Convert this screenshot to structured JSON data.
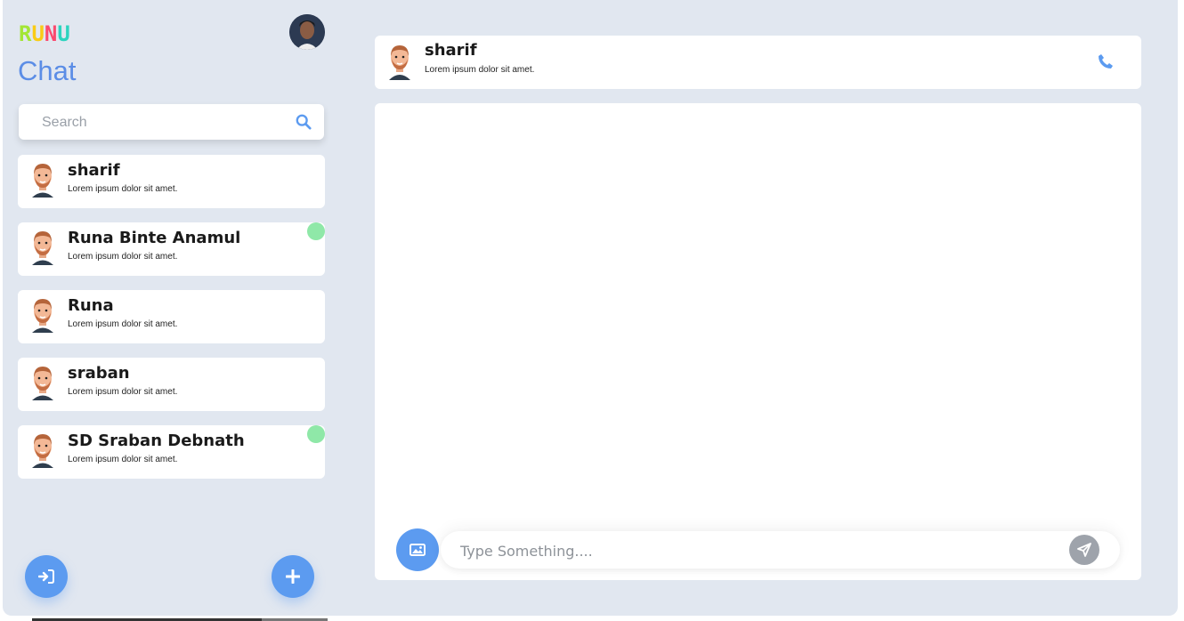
{
  "logo": {
    "letters": [
      {
        "char": "R",
        "color": "#a3e635"
      },
      {
        "char": "U",
        "color": "#facc15"
      },
      {
        "char": "N",
        "color": "#fb4a6e"
      },
      {
        "char": "U",
        "color": "#2dd4bf"
      }
    ]
  },
  "sidebar": {
    "title": "Chat",
    "profile_avatar_icon": "profile-photo",
    "search": {
      "placeholder": "Search",
      "icon": "search-icon"
    },
    "contacts": [
      {
        "name": "sharif",
        "preview": "Lorem ipsum dolor sit amet.",
        "online": false
      },
      {
        "name": "Runa Binte Anamul",
        "preview": "Lorem ipsum dolor sit amet.",
        "online": true
      },
      {
        "name": "Runa",
        "preview": "Lorem ipsum dolor sit amet.",
        "online": false
      },
      {
        "name": "sraban",
        "preview": "Lorem ipsum dolor sit amet.",
        "online": false
      },
      {
        "name": "SD Sraban Debnath",
        "preview": "Lorem ipsum dolor sit amet.",
        "online": true
      }
    ],
    "logout_icon": "logout-icon",
    "add_icon": "plus-icon"
  },
  "chat": {
    "header": {
      "name": "sharif",
      "status": "Lorem ipsum dolor sit amet.",
      "call_icon": "phone-icon"
    },
    "composer": {
      "placeholder": "Type Something....",
      "image_icon": "image-icon",
      "send_icon": "send-icon"
    }
  },
  "colors": {
    "background": "#e1e7f0",
    "accent": "#5c9bf0",
    "title": "#5b8de6",
    "online": "#8fe8a8",
    "send_button": "#9ea3ab"
  }
}
